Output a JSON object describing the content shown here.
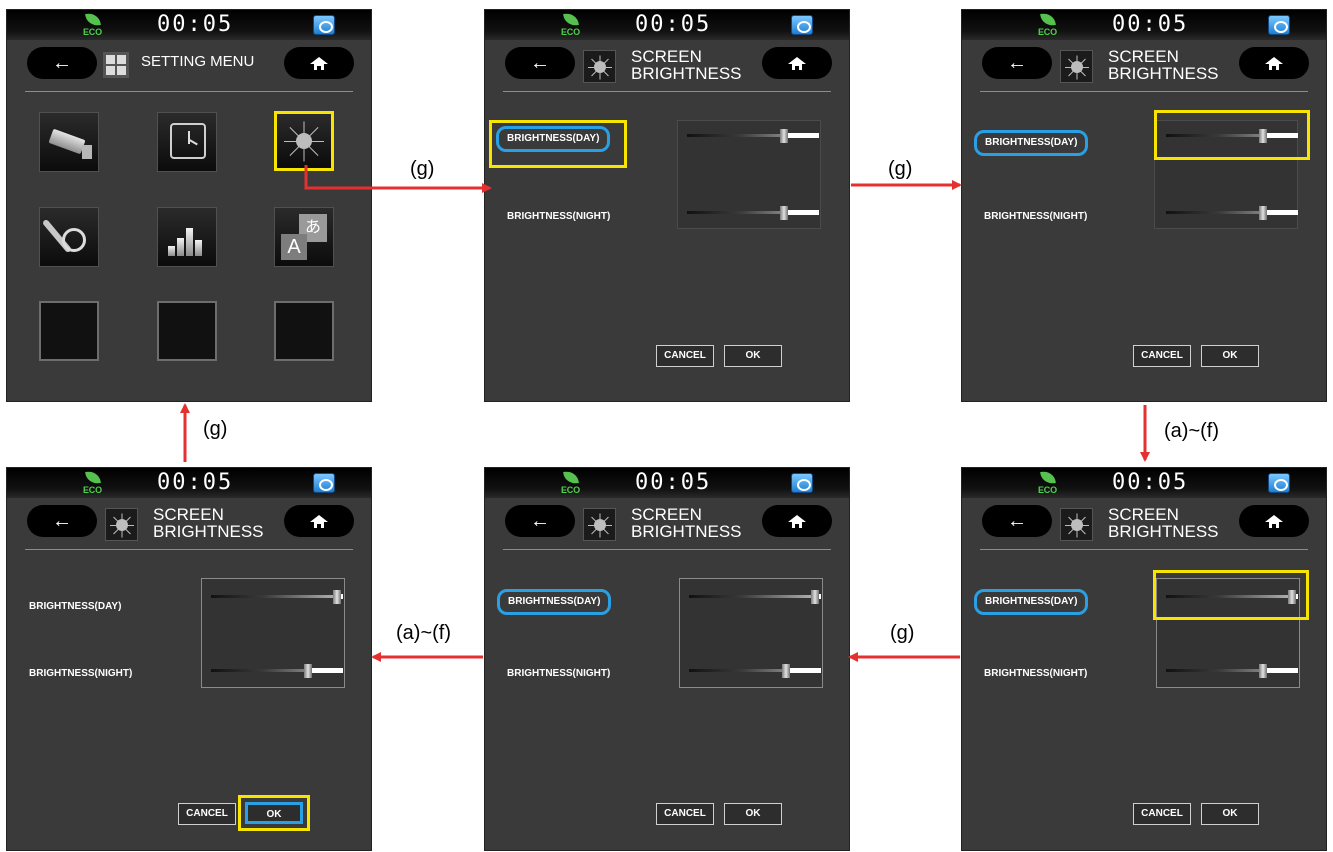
{
  "status": {
    "eco_label": "ECO",
    "clock": "00:05"
  },
  "setting_menu": {
    "title": "SETTING MENU"
  },
  "brightness_screen": {
    "title_line1": "SCREEN",
    "title_line2": "BRIGHTNESS",
    "day_label": "BRIGHTNESS(DAY)",
    "night_label": "BRIGHTNESS(NIGHT)",
    "cancel_label": "CANCEL",
    "ok_label": "OK"
  },
  "screens": [
    {
      "name": "screen-1",
      "kind": "setting-menu"
    },
    {
      "name": "screen-2",
      "kind": "brightness",
      "day_level": 0.75,
      "night_level": 0.75
    },
    {
      "name": "screen-3",
      "kind": "brightness",
      "day_level": 0.75,
      "night_level": 0.75
    },
    {
      "name": "screen-4",
      "kind": "brightness",
      "day_level": 0.98,
      "night_level": 0.75
    },
    {
      "name": "screen-5",
      "kind": "brightness",
      "day_level": 0.98,
      "night_level": 0.75
    },
    {
      "name": "screen-6",
      "kind": "brightness",
      "day_level": 0.98,
      "night_level": 0.75
    }
  ],
  "transitions": {
    "g1": "(g)",
    "g2": "(g)",
    "af1": "(a)~(f)",
    "g3": "(g)",
    "af2": "(a)~(f)",
    "g4": "(g)"
  },
  "colors": {
    "highlight_yellow": "#f7e400",
    "focus_blue": "#2aa0e4",
    "arrow_red": "#e53030",
    "eco_green": "#4cd14c"
  },
  "icons": [
    "back-arrow-icon",
    "home-icon",
    "camera-icon",
    "clock-icon",
    "brightness-icon",
    "tools-timer-icon",
    "equalizer-icon",
    "language-icon",
    "menu-grid-icon",
    "eco-leaf-icon",
    "e-card-icon"
  ]
}
